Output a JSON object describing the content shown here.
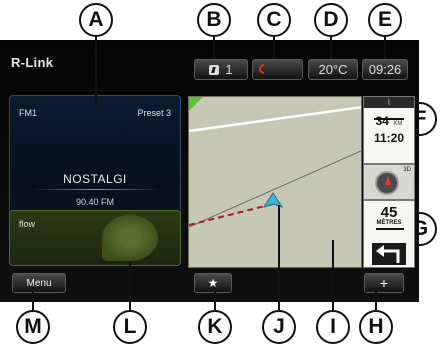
{
  "callouts": {
    "A": "A",
    "B": "B",
    "C": "C",
    "D": "D",
    "E": "E",
    "F": "F",
    "G": "G",
    "H": "H",
    "I": "I",
    "J": "J",
    "K": "K",
    "L": "L",
    "M": "M"
  },
  "app": {
    "logo": "R-Link"
  },
  "status": {
    "messages_count": "1",
    "temperature": "20°C",
    "time": "09:26",
    "phone_icon": "phone-icon",
    "message_icon": "message-icon"
  },
  "radio": {
    "band": "FM1",
    "preset": "Preset 3",
    "station": "NOSTALGI",
    "frequency": "90.40 FM"
  },
  "flow": {
    "title": "flow"
  },
  "nav": {
    "distance_remaining": "34",
    "distance_unit": "KM",
    "eta": "11:20",
    "view_mode": "3D",
    "next_turn_distance": "45",
    "next_turn_unit": "MÈTRES",
    "next_turn_direction": "left"
  },
  "bottom": {
    "menu_label": "Menu",
    "favorite_icon": "star-icon",
    "map_menu_icon": "plus-icon"
  },
  "colors": {
    "map_ground": "#c6c8b4",
    "route": "#b11a1a",
    "vehicle": "#3cb6d6",
    "radio_accent": "#4aa7ff"
  }
}
